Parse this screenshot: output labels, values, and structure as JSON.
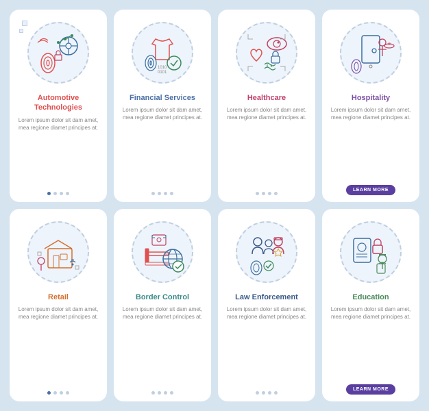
{
  "cards": [
    {
      "id": "automotive",
      "title": "Automotive Technologies",
      "title_color": "red",
      "desc": "Lorem ipsum dolor sit dam amet, mea regione diamet principes at.",
      "dots": [
        true,
        false,
        false,
        false
      ],
      "show_btn": false
    },
    {
      "id": "financial",
      "title": "Financial Services",
      "title_color": "blue",
      "desc": "Lorem ipsum dolor sit dam amet, mea regione diamet principes at.",
      "dots": [
        false,
        false,
        false,
        false
      ],
      "show_btn": false
    },
    {
      "id": "healthcare",
      "title": "Healthcare",
      "title_color": "pink",
      "desc": "Lorem ipsum dolor sit dam amet, mea regione diamet principes at.",
      "dots": [
        false,
        false,
        false,
        false
      ],
      "show_btn": false
    },
    {
      "id": "hospitality",
      "title": "Hospitality",
      "title_color": "purple",
      "desc": "Lorem ipsum dolor sit dam amet, mea regione diamet principes at.",
      "dots": [
        false,
        false,
        false,
        false
      ],
      "show_btn": true,
      "btn_label": "LEARN MORE"
    },
    {
      "id": "retail",
      "title": "Retail",
      "title_color": "orange",
      "desc": "Lorem ipsum dolor sit dam amet, mea regione diamet principes at.",
      "dots": [
        true,
        false,
        false,
        false
      ],
      "show_btn": false
    },
    {
      "id": "border",
      "title": "Border Control",
      "title_color": "teal",
      "desc": "Lorem ipsum dolor sit dam amet, mea regione diamet principes at.",
      "dots": [
        false,
        false,
        false,
        false
      ],
      "show_btn": false
    },
    {
      "id": "law",
      "title": "Law Enforcement",
      "title_color": "darkblue",
      "desc": "Lorem ipsum dolor sit dam amet, mea regione diamet principes at.",
      "dots": [
        false,
        false,
        false,
        false
      ],
      "show_btn": false
    },
    {
      "id": "education",
      "title": "Education",
      "title_color": "green",
      "desc": "Lorem ipsum dolor sit dam amet, mea regione diamet principes at.",
      "dots": [
        false,
        false,
        false,
        false
      ],
      "show_btn": true,
      "btn_label": "LEARN MORE"
    }
  ]
}
